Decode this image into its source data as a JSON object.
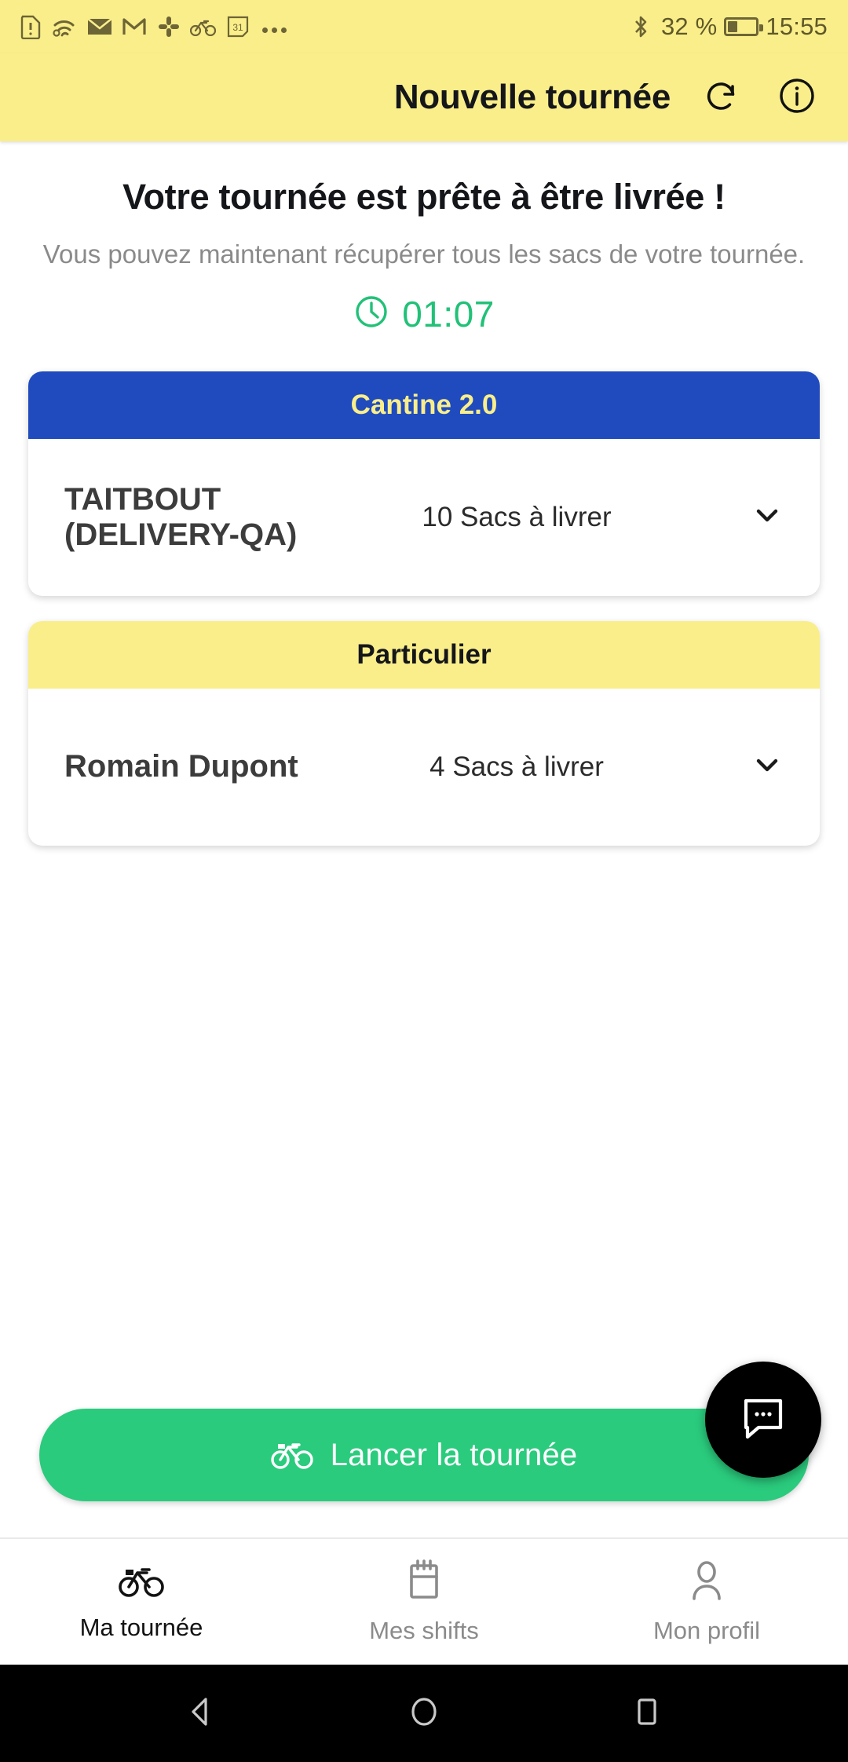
{
  "statusbar": {
    "icons": [
      "sim-alert-icon",
      "wifi-icon",
      "envelope-icon",
      "gmail-icon",
      "slack-icon",
      "bike-icon",
      "calendar-31-icon",
      "overflow-dots-icon"
    ],
    "calendar_day": "31",
    "bluetooth_icon": "bluetooth-icon",
    "battery_percent": "32 %",
    "battery_level": 32,
    "clock": "15:55"
  },
  "appbar": {
    "title": "Nouvelle tournée",
    "refresh_icon": "refresh-icon",
    "info_icon": "info-icon",
    "background": "#FAEE8B"
  },
  "main": {
    "headline": "Votre tournée est prête à être livrée !",
    "subhead": "Vous pouvez maintenant récupérer tous les sacs de votre tournée.",
    "timer": {
      "icon": "clock-icon",
      "value": "01:07",
      "color": "#22c178"
    },
    "cards": [
      {
        "header_label": "Cantine 2.0",
        "header_style": "blue",
        "header_bg": "#1F4BBF",
        "header_color": "#FAEE8B",
        "name": "TAITBOUT (DELIVERY-QA)",
        "count_label": "10 Sacs à livrer",
        "chevron_icon": "chevron-down-icon"
      },
      {
        "header_label": "Particulier",
        "header_style": "yellow",
        "header_bg": "#FAEE8B",
        "header_color": "#15161a",
        "name": "Romain Dupont",
        "count_label": "4 Sacs à livrer",
        "chevron_icon": "chevron-down-icon"
      }
    ],
    "cta": {
      "label": "Lancer la tournée",
      "icon": "bike-icon",
      "color": "#2ACB7D"
    },
    "fab": {
      "icon": "chat-bubble-icon",
      "color": "#000000"
    }
  },
  "bottomnav": {
    "items": [
      {
        "label": "Ma tournée",
        "icon": "bike-icon",
        "active": true
      },
      {
        "label": "Mes shifts",
        "icon": "calendar-icon",
        "active": false
      },
      {
        "label": "Mon profil",
        "icon": "person-icon",
        "active": false
      }
    ]
  },
  "androidnav": {
    "back_icon": "back-triangle-icon",
    "home_icon": "home-circle-icon",
    "recents_icon": "recents-square-icon"
  }
}
